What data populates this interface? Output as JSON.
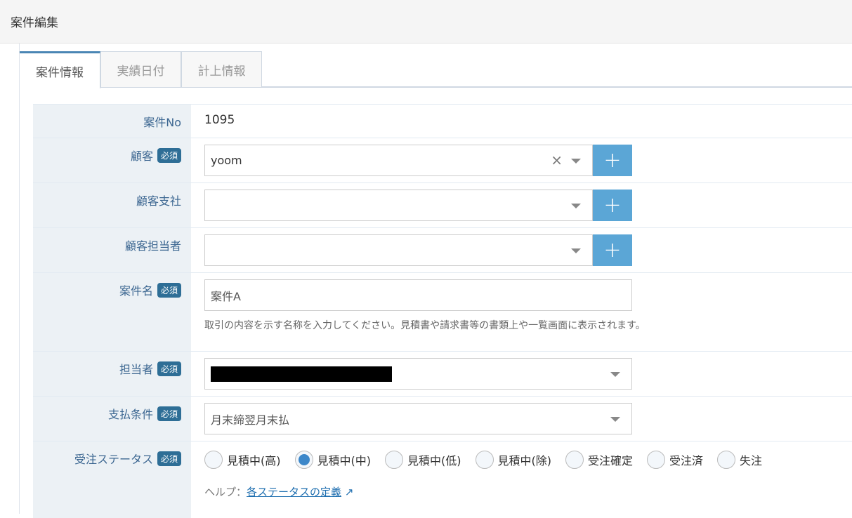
{
  "header": {
    "title": "案件編集"
  },
  "tabs": [
    {
      "label": "案件情報"
    },
    {
      "label": "実績日付"
    },
    {
      "label": "計上情報"
    }
  ],
  "required_badge": "必須",
  "fields": {
    "case_no": {
      "label": "案件No",
      "value": "1095"
    },
    "customer": {
      "label": "顧客",
      "value": "yoom",
      "clear": "×",
      "add": "+"
    },
    "customer_branch": {
      "label": "顧客支社",
      "value": "",
      "add": "+"
    },
    "customer_contact": {
      "label": "顧客担当者",
      "value": "",
      "add": "+"
    },
    "case_name": {
      "label": "案件名",
      "value": "案件A",
      "hint": "取引の内容を示す名称を入力してください。見積書や請求書等の書類上や一覧画面に表示されます。"
    },
    "owner": {
      "label": "担当者"
    },
    "payment_terms": {
      "label": "支払条件",
      "value": "月末締翌月末払"
    },
    "order_status": {
      "label": "受注ステータス",
      "options": [
        "見積中(高)",
        "見積中(中)",
        "見積中(低)",
        "見積中(除)",
        "受注確定",
        "受注済",
        "失注"
      ],
      "selected": "見積中(中)",
      "help_label": "ヘルプ：",
      "help_link": "各ステータスの定義",
      "help_icon": "↗"
    }
  }
}
